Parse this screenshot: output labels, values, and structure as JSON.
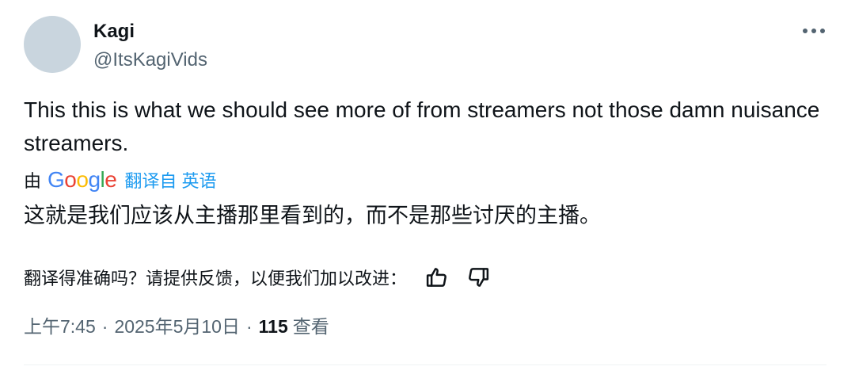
{
  "author": {
    "name": "Kagi",
    "handle": "@ItsKagiVids"
  },
  "tweet": {
    "text": "This this is what we should see more of from streamers not those damn nuisance streamers."
  },
  "translation": {
    "prefix": "由",
    "provider": "Google",
    "link_label": "翻译自 英语",
    "text": "这就是我们应该从主播那里看到的，而不是那些讨厌的主播。"
  },
  "feedback": {
    "prompt": "翻译得准确吗？请提供反馈，以便我们加以改进："
  },
  "meta": {
    "time": "上午7:45",
    "date": "2025年5月10日",
    "separator": "·",
    "views_count": "115",
    "views_label": "查看"
  },
  "icons": {
    "more": "more-horizontal-icon",
    "thumbs_up": "thumbs-up-icon",
    "thumbs_down": "thumbs-down-icon"
  },
  "colors": {
    "text": "#0f1419",
    "secondary": "#536471",
    "accent": "#1d9bf0",
    "avatar": "#c9d5de",
    "google_blue": "#4285f4",
    "google_red": "#ea4335",
    "google_yellow": "#fbbc05",
    "google_green": "#34a853"
  }
}
